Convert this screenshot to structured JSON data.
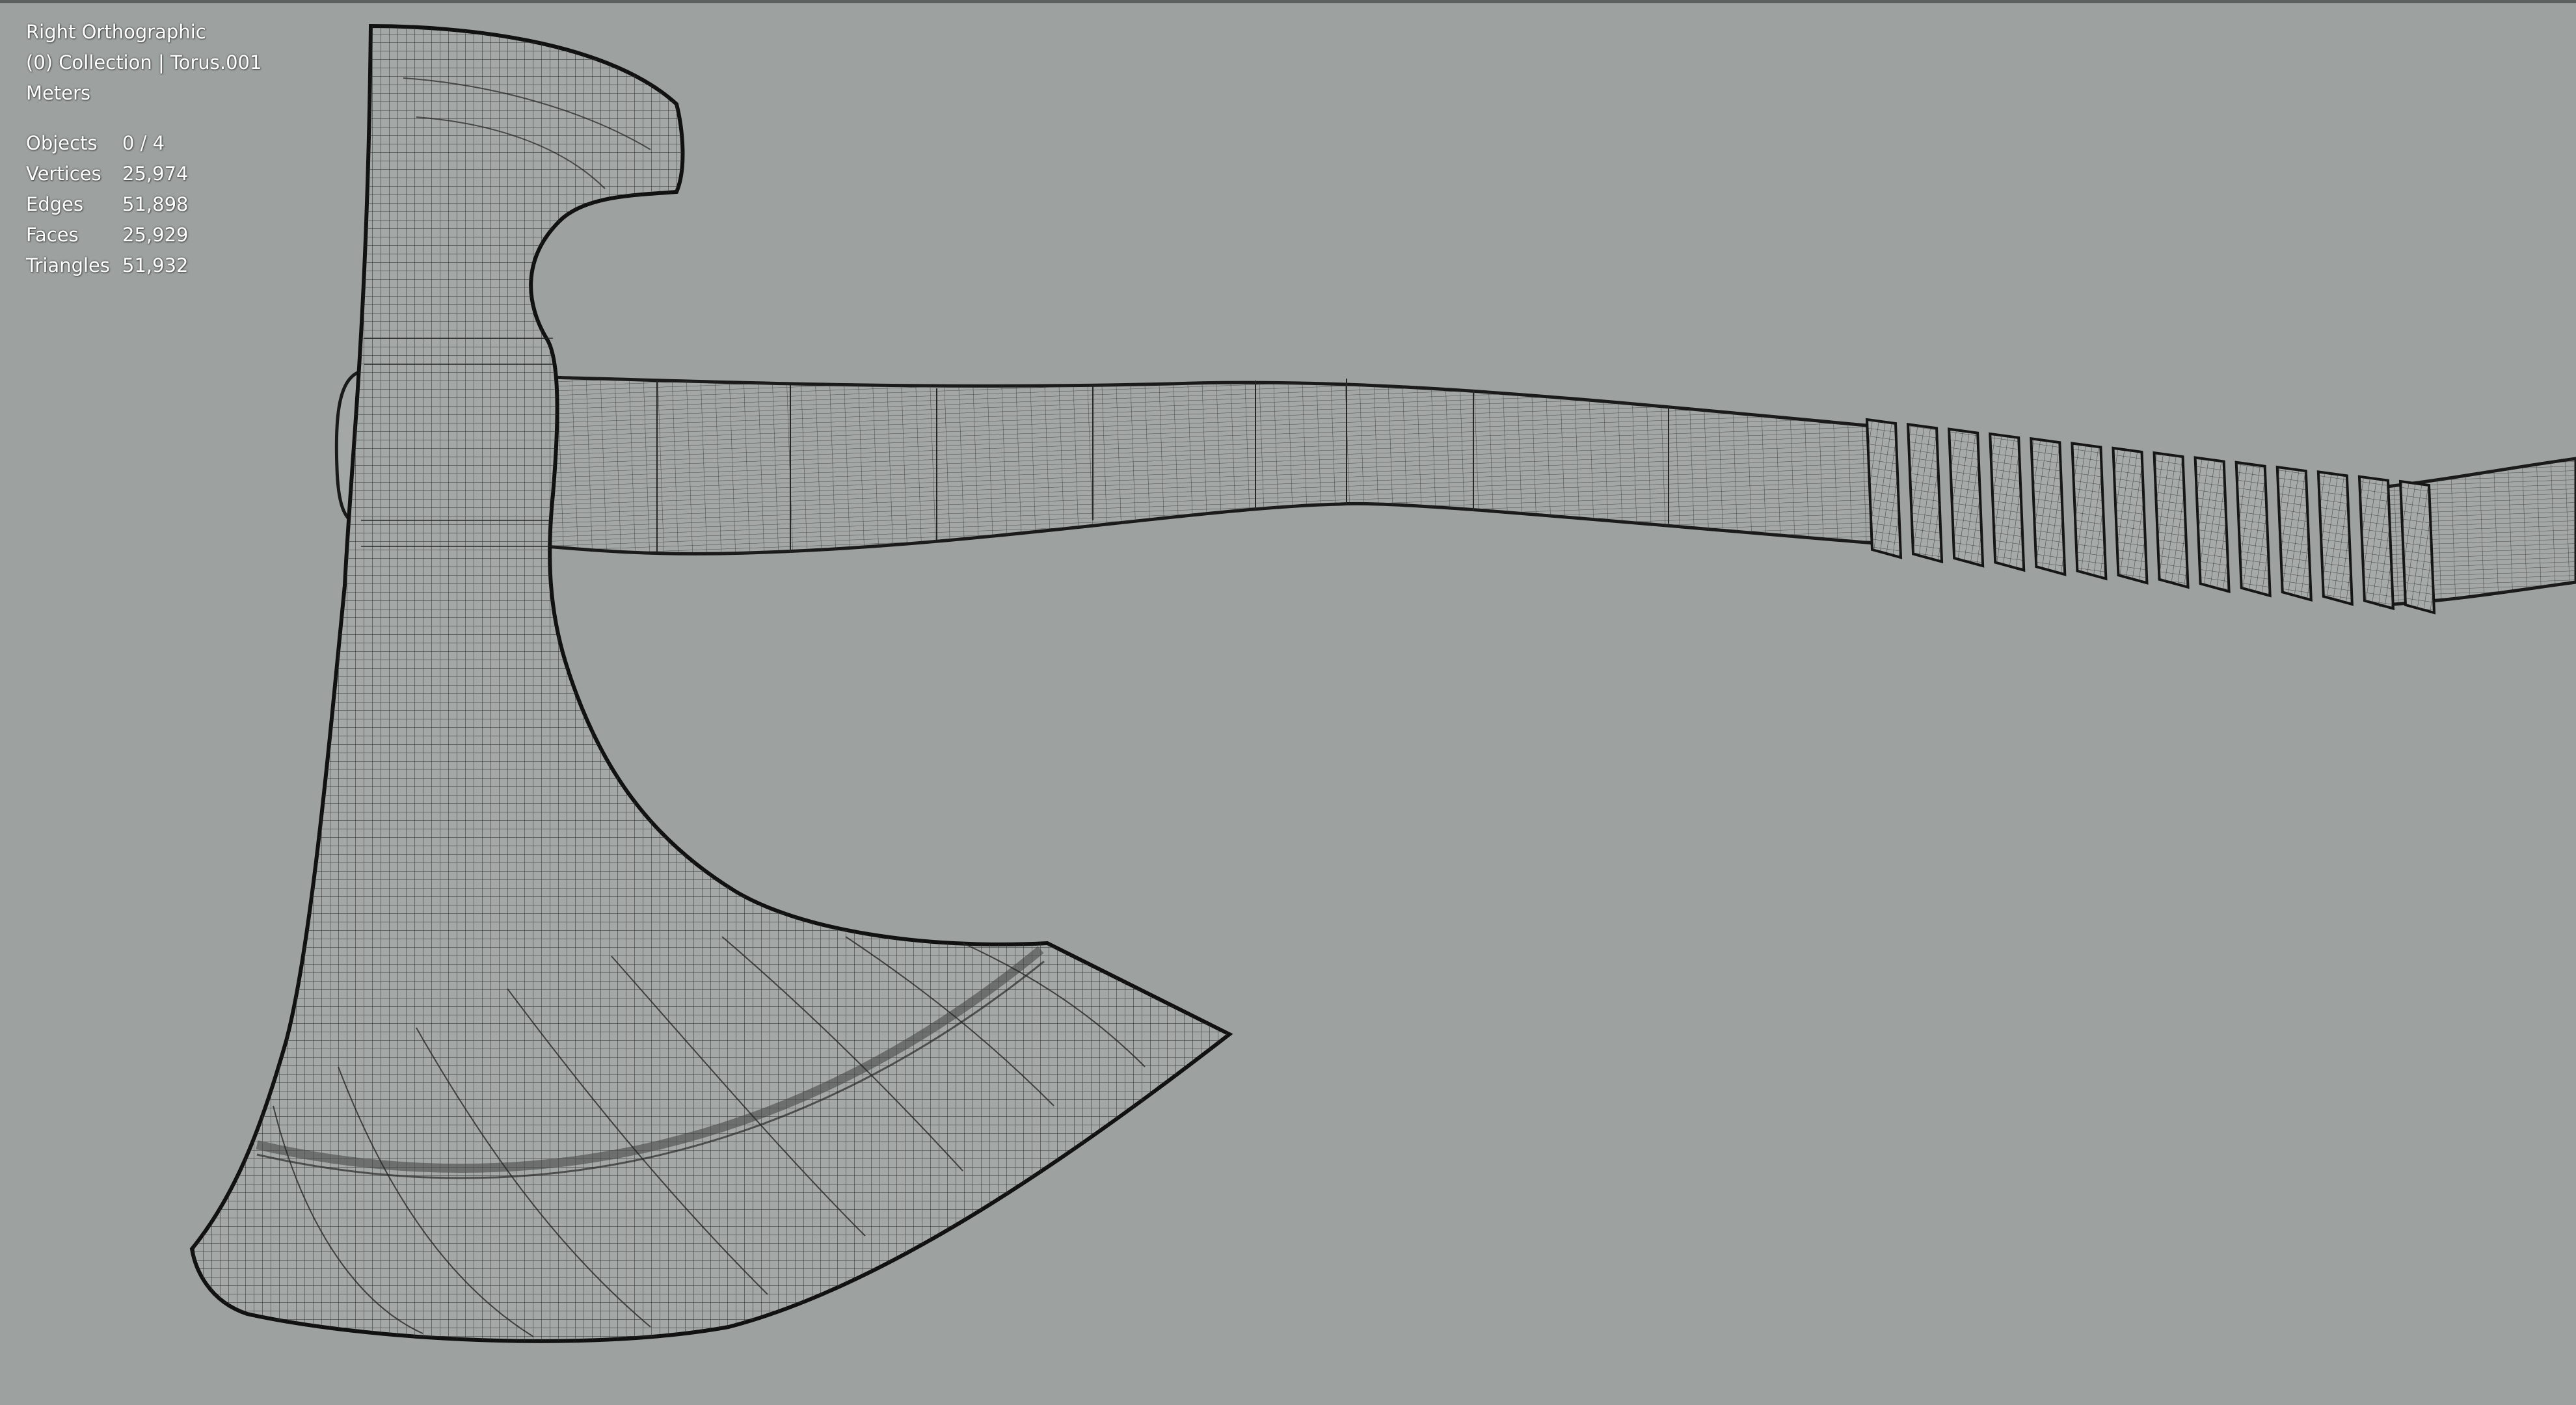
{
  "viewport": {
    "view_name": "Right Orthographic",
    "collection_line": "(0) Collection | Torus.001",
    "units": "Meters",
    "background_color": "#9da2a1",
    "wire_color": "#1c1c1c",
    "mesh_fill_color": "#a4a9a8"
  },
  "stats": [
    {
      "label": "Objects",
      "value": "0 / 4"
    },
    {
      "label": "Vertices",
      "value": "25,974"
    },
    {
      "label": "Edges",
      "value": "51,898"
    },
    {
      "label": "Faces",
      "value": "25,929"
    },
    {
      "label": "Triangles",
      "value": "51,932"
    }
  ],
  "scene": {
    "objects": [
      {
        "name": "axe-head",
        "icon": "mesh-wireframe"
      },
      {
        "name": "axe-handle",
        "icon": "mesh-wireframe"
      },
      {
        "name": "handle-wrap",
        "icon": "mesh-wireframe"
      }
    ]
  }
}
